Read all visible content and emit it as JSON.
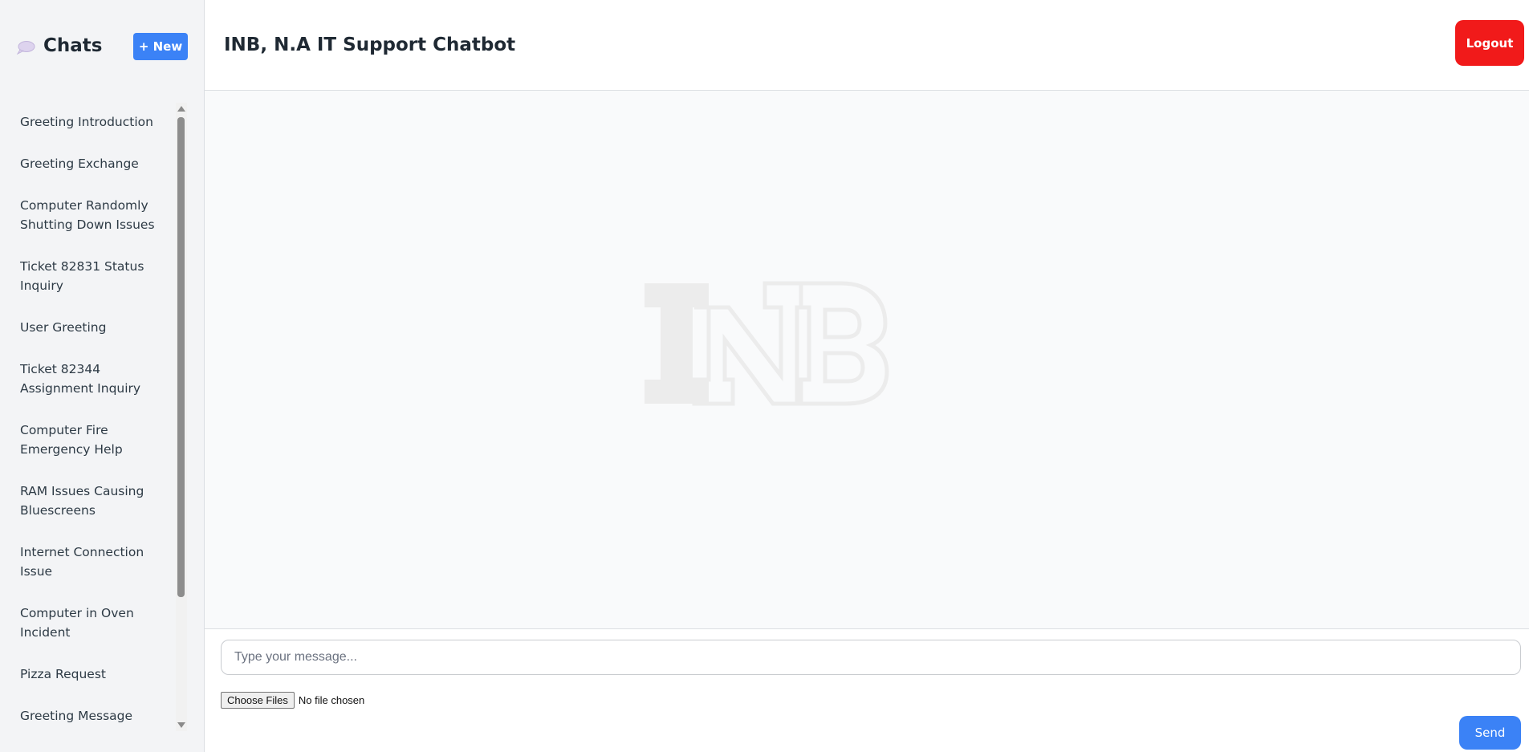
{
  "sidebar": {
    "title": "Chats",
    "icon": "chat-bubble-icon",
    "new_label": "+ New",
    "items": [
      "Greeting Introduction",
      "Greeting Exchange",
      "Computer Randomly Shutting Down Issues",
      "Ticket 82831 Status Inquiry",
      "User Greeting",
      "Ticket 82344 Assignment Inquiry",
      "Computer Fire Emergency Help",
      "RAM Issues Causing Bluescreens",
      "Internet Connection Issue",
      "Computer in Oven Incident",
      "Pizza Request",
      "Greeting Message"
    ]
  },
  "header": {
    "title": "INB, N.A IT Support Chatbot",
    "logout_label": "Logout"
  },
  "watermark": {
    "text": "INB"
  },
  "composer": {
    "placeholder": "Type your message...",
    "value": "",
    "choose_files_label": "Choose Files",
    "file_status": "No file chosen",
    "send_label": "Send"
  },
  "colors": {
    "primary": "#3b82f6",
    "danger": "#f11a1a",
    "sidebar_bg": "#f3f4f6",
    "chat_bg": "#f9fafb",
    "watermark": "#ececec"
  }
}
